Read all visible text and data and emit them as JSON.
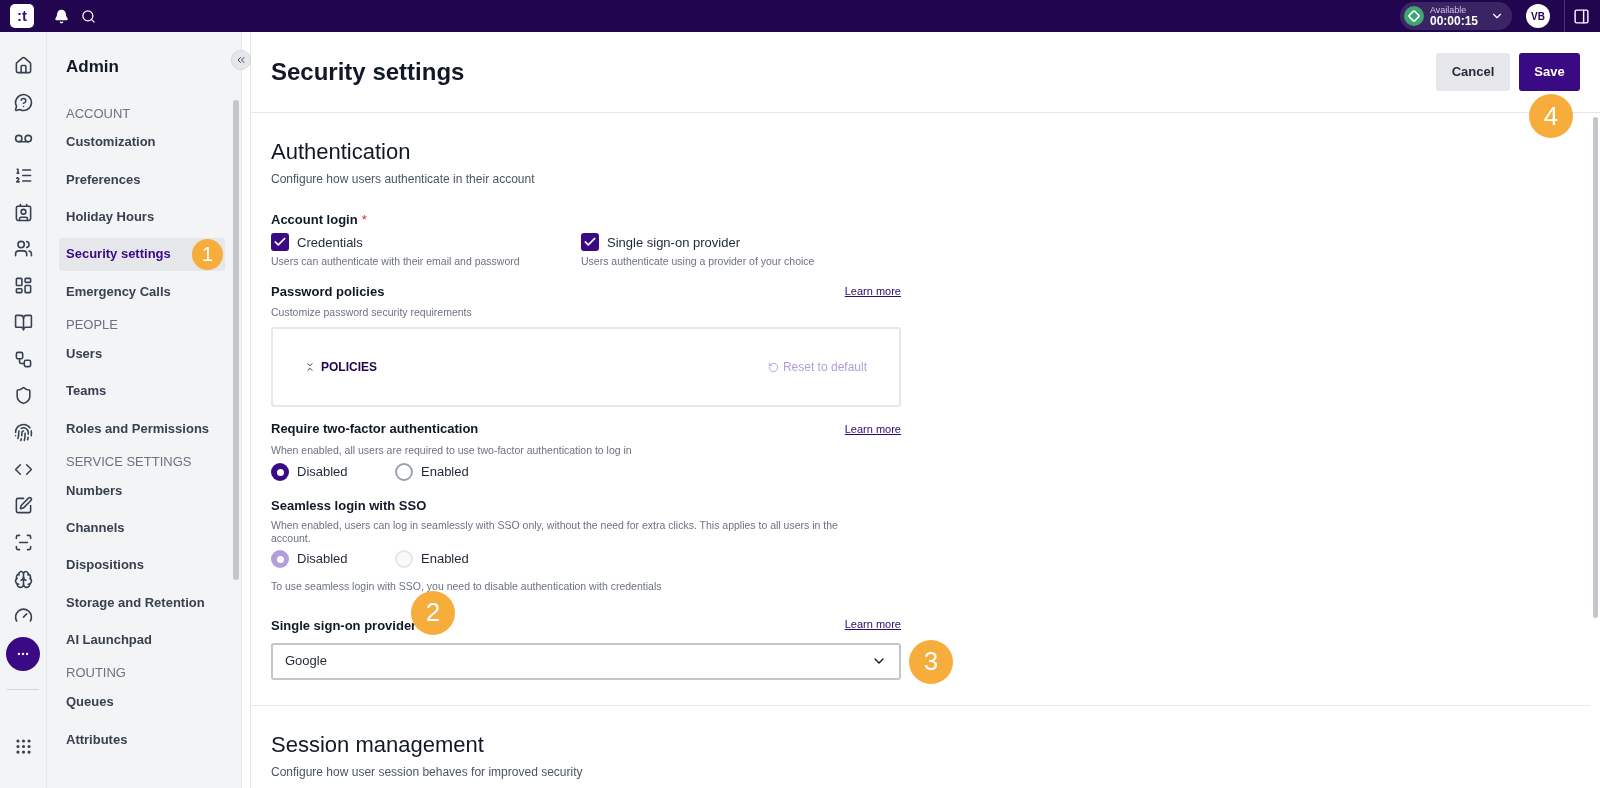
{
  "top_bar": {
    "logo": ":t",
    "status": {
      "label": "Available",
      "timer": "00:00:15"
    },
    "avatar": "VB"
  },
  "sidebar": {
    "title": "Admin",
    "sections": [
      {
        "heading": "ACCOUNT",
        "items": [
          {
            "label": "Customization",
            "selected": false
          },
          {
            "label": "Preferences",
            "selected": false
          },
          {
            "label": "Holiday Hours",
            "selected": false
          },
          {
            "label": "Security settings",
            "selected": true,
            "callout": "1"
          },
          {
            "label": "Emergency Calls",
            "selected": false
          }
        ]
      },
      {
        "heading": "PEOPLE",
        "items": [
          {
            "label": "Users",
            "selected": false
          },
          {
            "label": "Teams",
            "selected": false
          },
          {
            "label": "Roles and Permissions",
            "selected": false
          }
        ]
      },
      {
        "heading": "SERVICE SETTINGS",
        "items": [
          {
            "label": "Numbers",
            "selected": false
          },
          {
            "label": "Channels",
            "selected": false
          },
          {
            "label": "Dispositions",
            "selected": false
          },
          {
            "label": "Storage and Retention",
            "selected": false
          },
          {
            "label": "AI Launchpad",
            "selected": false
          }
        ]
      },
      {
        "heading": "ROUTING",
        "items": [
          {
            "label": "Queues",
            "selected": false
          },
          {
            "label": "Attributes",
            "selected": false
          }
        ]
      }
    ]
  },
  "page": {
    "title": "Security settings",
    "buttons": [
      {
        "label": "Cancel",
        "kind": "secondary"
      },
      {
        "label": "Save",
        "kind": "primary",
        "callout": "4"
      }
    ]
  },
  "authentication": {
    "title": "Authentication",
    "subtitle": "Configure how users authenticate in their account",
    "account_login": {
      "label": "Account login",
      "required_mark": "*",
      "options": [
        {
          "label": "Credentials",
          "hint": "Users can authenticate with their email and password",
          "checked": true
        },
        {
          "label": "Single sign-on provider",
          "hint": "Users authenticate using a provider of your choice",
          "checked": true
        }
      ]
    },
    "password_policies": {
      "label": "Password policies",
      "link": "Learn more",
      "hint": "Customize password security requirements",
      "panel_title": "POLICIES",
      "reset": "Reset to default"
    },
    "two_factor": {
      "label": "Require two-factor authentication",
      "link": "Learn more",
      "hint": "When enabled, all users are required to use two-factor authentication to log in",
      "disabled": false,
      "options": [
        {
          "label": "Disabled",
          "selected": true
        },
        {
          "label": "Enabled",
          "selected": false
        }
      ]
    },
    "seamless_sso": {
      "label": "Seamless login with SSO",
      "hint": "When enabled, users can log in seamlessly with SSO only, without the need for extra clicks. This applies to all users in the account.",
      "disabled": true,
      "options": [
        {
          "label": "Disabled",
          "selected": true
        },
        {
          "label": "Enabled",
          "selected": false
        }
      ],
      "note": "To use seamless login with SSO, you need to disable authentication with credentials"
    },
    "sso_provider": {
      "label": "Single sign-on provider",
      "label_callout": "2",
      "link": "Learn more",
      "value": "Google",
      "select_callout": "3"
    }
  },
  "session_management": {
    "title": "Session management",
    "subtitle": "Configure how user session behaves for improved security"
  }
}
